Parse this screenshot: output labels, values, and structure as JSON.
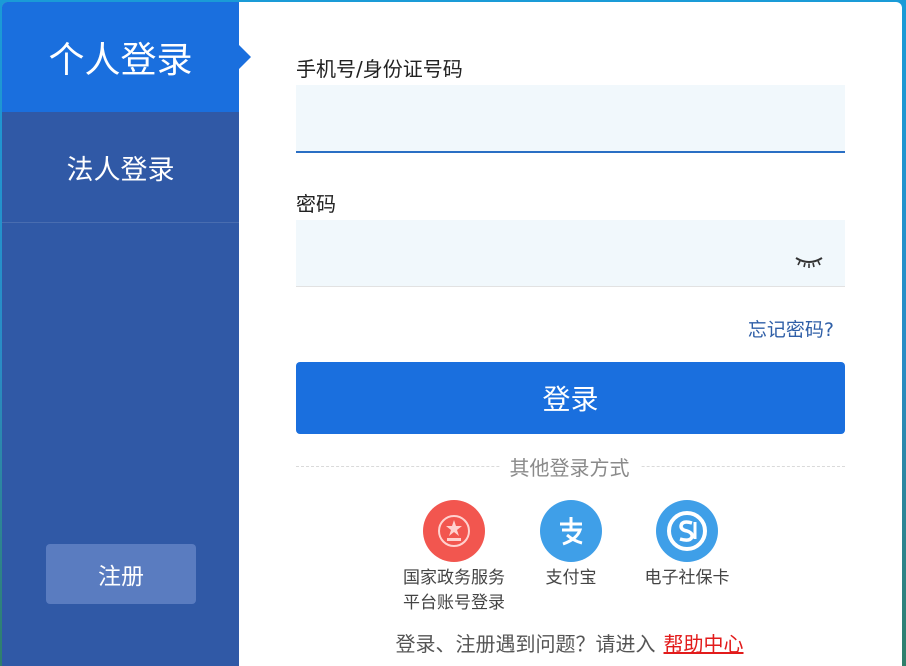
{
  "sidebar": {
    "tabs": [
      {
        "label": "个人登录",
        "active": true
      },
      {
        "label": "法人登录",
        "active": false
      }
    ],
    "register_label": "注册"
  },
  "form": {
    "phone_label": "手机号/身份证号码",
    "phone_value": "",
    "password_label": "密码",
    "password_value": "",
    "forgot_label": "忘记密码?",
    "login_label": "登录"
  },
  "other_login": {
    "title": "其他登录方式",
    "methods": [
      {
        "label_line1": "国家政务服务",
        "label_line2": "平台账号登录",
        "icon": "national-emblem-icon",
        "color": "#f2564f"
      },
      {
        "label_line1": "支付宝",
        "label_line2": "",
        "icon": "alipay-icon",
        "color": "#3f9fe8"
      },
      {
        "label_line1": "电子社保卡",
        "label_line2": "",
        "icon": "social-security-card-icon",
        "color": "#3f9fe8"
      }
    ]
  },
  "help": {
    "text": "登录、注册遇到问题？请进入",
    "link_label": "帮助中心"
  },
  "colors": {
    "primary": "#1a6fde",
    "sidebar": "#3059a6",
    "link": "#2f5fa7",
    "help_link": "#e21b1b"
  }
}
